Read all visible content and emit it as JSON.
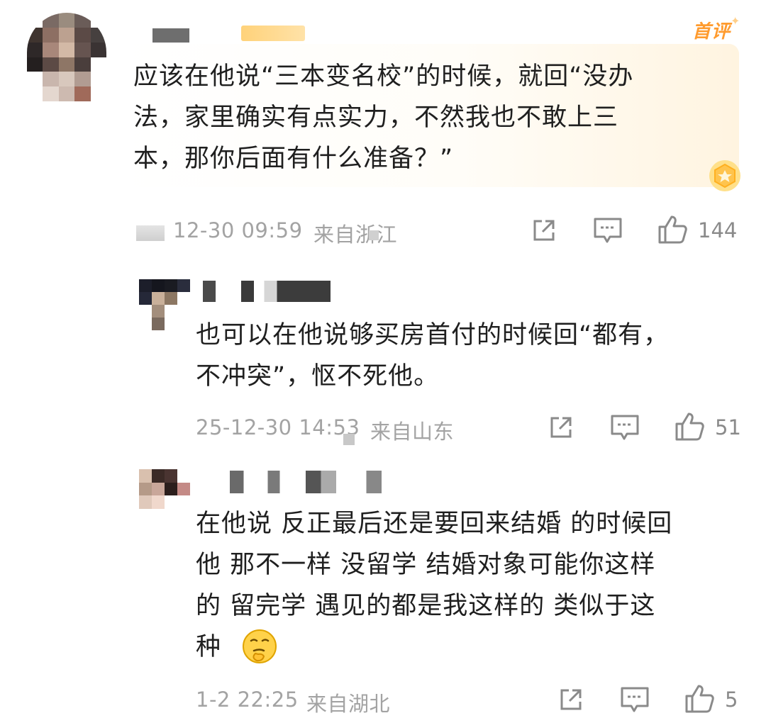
{
  "top_badge": "首评",
  "comments": [
    {
      "text": "应该在他说“三本变名校”的时候，就回“没办\n法，家里确实有点实力，不然我也不敢上三\n本，那你后面有什么准备？”",
      "time": "12-30 09:59",
      "location": "来自浙江",
      "likes": "144"
    },
    {
      "text": "也可以在他说够买房首付的时候回“都有，\n不冲突”，怄不死他。",
      "time": "25-12-30 14:53",
      "location": "来自山东",
      "likes": "51"
    },
    {
      "text": "在他说 反正最后还是要回来结婚 的时候回\n他 那不一样 没留学 结婚对象可能你这样\n的 留完学 遇见的都是我这样的 类似于这\n种",
      "emoji": "thinking-face-emoji",
      "time": "1-2 22:25",
      "location": "来自湖北",
      "likes": "5"
    }
  ],
  "icons": [
    "share-icon",
    "reply-icon",
    "thumbs-up-icon",
    "medal-icon"
  ],
  "colors": {
    "badge": "#ff9b2e",
    "meta": "#a3a3a3",
    "highlight": "#fff4e0"
  }
}
